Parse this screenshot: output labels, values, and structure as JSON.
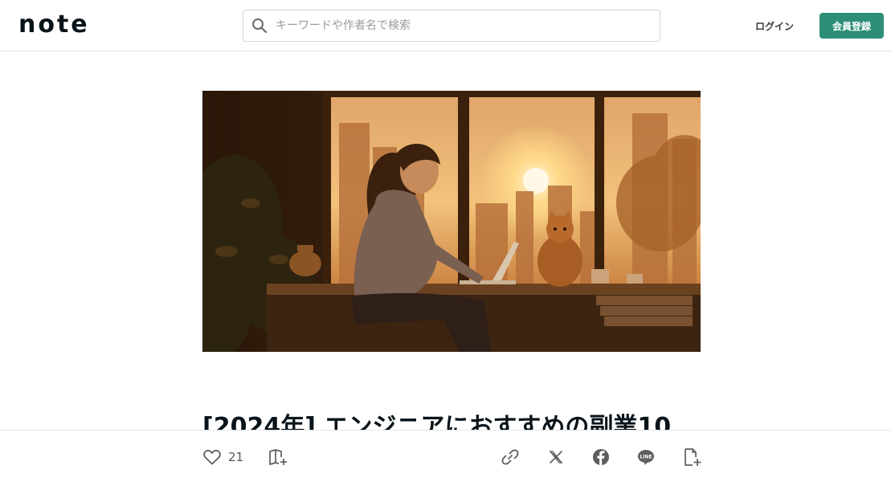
{
  "header": {
    "logo_text": "note",
    "search_placeholder": "キーワードや作者名で検索",
    "login_label": "ログイン",
    "signup_label": "会員登録"
  },
  "colors": {
    "accent": "#2c8e77",
    "text": "#08131a"
  },
  "article": {
    "title": "[2024年] エンジニアにおすすめの副業10"
  },
  "actions": {
    "like_count": "21",
    "icons": [
      "heart-icon",
      "magazine-add-icon",
      "link-icon",
      "x-icon",
      "facebook-icon",
      "line-icon",
      "add-note-icon"
    ]
  }
}
